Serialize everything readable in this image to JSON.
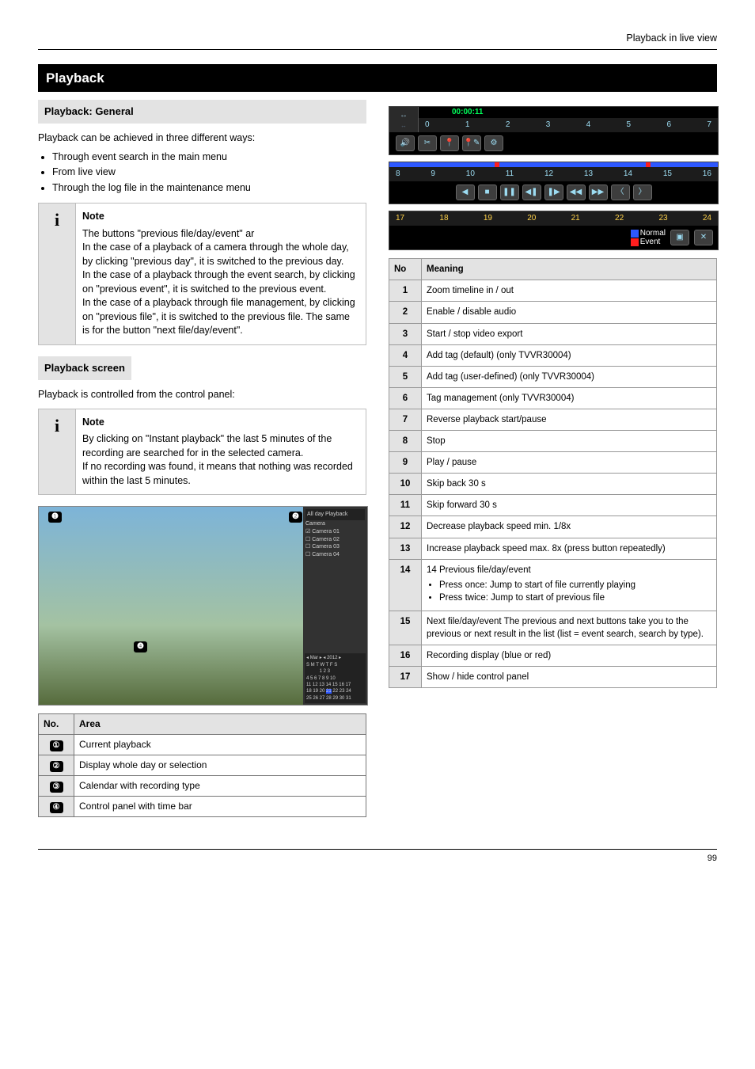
{
  "top_title": "Playback in live view",
  "section_title": "Playback",
  "left": {
    "sub1_title": "Playback: General",
    "intro": "Playback can be achieved in three different ways:",
    "ways": [
      "Through event search in the main menu",
      "From live view",
      "Through the log file in the maintenance menu"
    ],
    "note1_title": "Note",
    "note1_body_a": "The buttons \"previous file/day/event\" ar",
    "note1_body_b": "In the case of a playback of a camera through the whole day, by clicking \"previous day\", it is switched to the previous day.",
    "note1_body_c": "In the case of a playback through the event search, by clicking on \"previous event\", it is switched to the previous event.",
    "note1_body_d": "In the case of a playback through file management, by clicking on \"previous file\", it is switched to the previous file. The same is for the button \"next file/day/event\".",
    "sub2_title": "Playback screen",
    "sub2_intro": "Playback is controlled from the control panel:",
    "note2_title": "Note",
    "note2_body_a": "By clicking on \"Instant playback\" the last 5 minutes of the recording are searched for in the selected camera.",
    "note2_body_b": "If no recording was found, it means that nothing was recorded within the last 5 minutes.",
    "screenshot": {
      "sidebar_title": "All day Playback",
      "cam_label": "Camera",
      "cams": [
        "Camera 01",
        "Camera 02",
        "Camera 03",
        "Camera 04"
      ],
      "month": "Mar",
      "year": "2012"
    },
    "legend_head_no": "No.",
    "legend_head_area": "Area",
    "legend": [
      {
        "no": "①",
        "txt": "Current playback"
      },
      {
        "no": "②",
        "txt": "Display whole day or selection"
      },
      {
        "no": "③",
        "txt": "Calendar with recording type"
      },
      {
        "no": "④",
        "txt": "Control panel with time bar"
      }
    ]
  },
  "right": {
    "bar1_time": "00:00:11",
    "bar1_ticks": [
      "0",
      "1",
      "2",
      "3",
      "4",
      "5",
      "6",
      "7"
    ],
    "bar2_ticks": [
      "8",
      "9",
      "10",
      "11",
      "12",
      "13",
      "14",
      "15",
      "16"
    ],
    "bar3_ticks": [
      "17",
      "18",
      "19",
      "20",
      "21",
      "22",
      "23",
      "24"
    ],
    "legend_normal": "Normal",
    "legend_event": "Event",
    "table_head_no": "No",
    "table_head_mean": "Meaning",
    "rows": [
      {
        "no": "1",
        "txt": "Zoom timeline in / out"
      },
      {
        "no": "2",
        "txt": "Enable / disable audio"
      },
      {
        "no": "3",
        "txt": "Start / stop video export"
      },
      {
        "no": "4",
        "txt": "Add tag (default) (only TVVR30004)"
      },
      {
        "no": "5",
        "txt": "Add tag (user-defined) (only TVVR30004)"
      },
      {
        "no": "6",
        "txt": "Tag management (only TVVR30004)"
      },
      {
        "no": "7",
        "txt": "Reverse playback start/pause"
      },
      {
        "no": "8",
        "txt": "Stop"
      },
      {
        "no": "9",
        "txt": "Play / pause"
      },
      {
        "no": "10",
        "txt": "Skip back 30 s"
      },
      {
        "no": "11",
        "txt": "Skip forward 30 s"
      },
      {
        "no": "12",
        "txt": "Decrease playback speed min. 1/8x"
      },
      {
        "no": "13",
        "txt": "Increase playback speed max. 8x (press button repeatedly)"
      },
      {
        "no": "14",
        "txt": "14  Previous file/day/event<ul><li>Press once: Jump to start of file currently playing</li><li>Press twice: Jump to start of previous file</li></ul>"
      },
      {
        "no": "15",
        "txt": "Next file/day/event The previous and next buttons take you to the previous or next result in the list (list = event search, search by type)."
      },
      {
        "no": "16",
        "txt": "Recording display (blue or red)"
      },
      {
        "no": "17",
        "txt": "Show / hide control panel"
      }
    ]
  },
  "footer": "99"
}
